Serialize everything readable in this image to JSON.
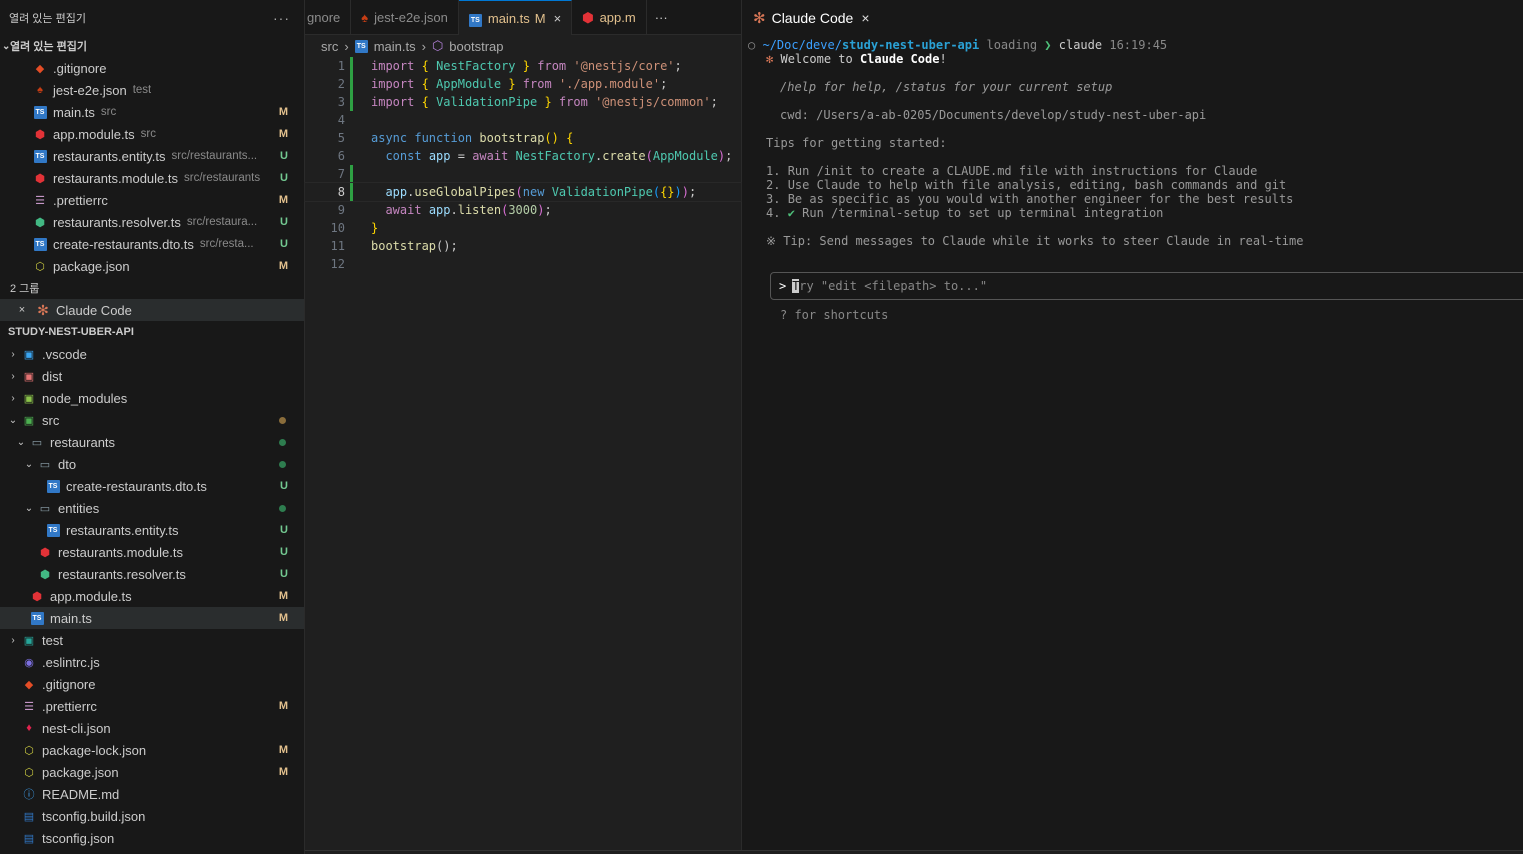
{
  "sidebar": {
    "header": "열려 있는 편집기",
    "more": "···",
    "open_editors_title": "열려 있는 편집기",
    "open_editors": [
      {
        "name": ".gitignore",
        "hint": "",
        "badge": "",
        "icon": "git-icon"
      },
      {
        "name": "jest-e2e.json",
        "hint": "test",
        "badge": "",
        "icon": "jest-icon"
      },
      {
        "name": "main.ts",
        "hint": "src",
        "badge": "M",
        "icon": "ts-icon"
      },
      {
        "name": "app.module.ts",
        "hint": "src",
        "badge": "M",
        "icon": "angular-icon"
      },
      {
        "name": "restaurants.entity.ts",
        "hint": "src/restaurants...",
        "badge": "U",
        "icon": "ts-icon"
      },
      {
        "name": "restaurants.module.ts",
        "hint": "src/restaurants",
        "badge": "U",
        "icon": "angular-icon"
      },
      {
        "name": ".prettierrc",
        "hint": "",
        "badge": "M",
        "icon": "prettier-icon"
      },
      {
        "name": "restaurants.resolver.ts",
        "hint": "src/restaura...",
        "badge": "U",
        "icon": "resolver-icon"
      },
      {
        "name": "create-restaurants.dto.ts",
        "hint": "src/resta...",
        "badge": "U",
        "icon": "ts-icon"
      },
      {
        "name": "package.json",
        "hint": "",
        "badge": "M",
        "icon": "json-icon"
      }
    ],
    "group2_title": "2 그룹",
    "group2_item": "Claude Code",
    "project_title": "STUDY-NEST-UBER-API",
    "tree": [
      {
        "name": ".vscode",
        "depth": 0,
        "twisty": "›",
        "icon": "vscode-folder-icon",
        "badge": "",
        "dot": ""
      },
      {
        "name": "dist",
        "depth": 0,
        "twisty": "›",
        "icon": "dist-folder-icon",
        "badge": "",
        "dot": ""
      },
      {
        "name": "node_modules",
        "depth": 0,
        "twisty": "›",
        "icon": "node-folder-icon",
        "badge": "",
        "dot": ""
      },
      {
        "name": "src",
        "depth": 0,
        "twisty": "⌄",
        "icon": "src-folder-icon",
        "badge": "",
        "dot": "#8a6d3b"
      },
      {
        "name": "restaurants",
        "depth": 1,
        "twisty": "⌄",
        "icon": "folder-icon",
        "badge": "",
        "dot": "#2e7d4f"
      },
      {
        "name": "dto",
        "depth": 2,
        "twisty": "⌄",
        "icon": "folder-icon",
        "badge": "",
        "dot": "#2e7d4f"
      },
      {
        "name": "create-restaurants.dto.ts",
        "depth": 3,
        "twisty": "",
        "icon": "ts-icon",
        "badge": "U",
        "dot": ""
      },
      {
        "name": "entities",
        "depth": 2,
        "twisty": "⌄",
        "icon": "folder-icon",
        "badge": "",
        "dot": "#2e7d4f"
      },
      {
        "name": "restaurants.entity.ts",
        "depth": 3,
        "twisty": "",
        "icon": "ts-icon",
        "badge": "U",
        "dot": ""
      },
      {
        "name": "restaurants.module.ts",
        "depth": 2,
        "twisty": "",
        "icon": "angular-icon",
        "badge": "U",
        "dot": ""
      },
      {
        "name": "restaurants.resolver.ts",
        "depth": 2,
        "twisty": "",
        "icon": "resolver-icon",
        "badge": "U",
        "dot": ""
      },
      {
        "name": "app.module.ts",
        "depth": 1,
        "twisty": "",
        "icon": "angular-icon",
        "badge": "M",
        "dot": ""
      },
      {
        "name": "main.ts",
        "depth": 1,
        "twisty": "",
        "icon": "ts-icon",
        "badge": "M",
        "dot": "",
        "selected": true
      },
      {
        "name": "test",
        "depth": 0,
        "twisty": "›",
        "icon": "test-folder-icon",
        "badge": "",
        "dot": ""
      },
      {
        "name": ".eslintrc.js",
        "depth": 0,
        "twisty": "",
        "icon": "eslint-icon",
        "badge": "",
        "dot": ""
      },
      {
        "name": ".gitignore",
        "depth": 0,
        "twisty": "",
        "icon": "git-icon",
        "badge": "",
        "dot": ""
      },
      {
        "name": ".prettierrc",
        "depth": 0,
        "twisty": "",
        "icon": "prettier-icon",
        "badge": "M",
        "dot": ""
      },
      {
        "name": "nest-cli.json",
        "depth": 0,
        "twisty": "",
        "icon": "nest-icon",
        "badge": "",
        "dot": ""
      },
      {
        "name": "package-lock.json",
        "depth": 0,
        "twisty": "",
        "icon": "json-icon",
        "badge": "M",
        "dot": ""
      },
      {
        "name": "package.json",
        "depth": 0,
        "twisty": "",
        "icon": "json-icon",
        "badge": "M",
        "dot": ""
      },
      {
        "name": "README.md",
        "depth": 0,
        "twisty": "",
        "icon": "info-icon",
        "badge": "",
        "dot": ""
      },
      {
        "name": "tsconfig.build.json",
        "depth": 0,
        "twisty": "",
        "icon": "tsconfig-icon",
        "badge": "",
        "dot": ""
      },
      {
        "name": "tsconfig.json",
        "depth": 0,
        "twisty": "",
        "icon": "tsconfig-icon",
        "badge": "",
        "dot": ""
      }
    ]
  },
  "editor": {
    "tabs": [
      {
        "label": "gnore",
        "mod": "",
        "icon": "",
        "active": false,
        "partial": true
      },
      {
        "label": "jest-e2e.json",
        "mod": "",
        "icon": "jest-icon",
        "active": false
      },
      {
        "label": "main.ts",
        "mod": "M",
        "icon": "ts-icon",
        "active": true
      },
      {
        "label": "app.m",
        "mod": "",
        "icon": "angular-icon",
        "active": false
      }
    ],
    "close_glyph": "×",
    "more": "···",
    "breadcrumb": {
      "a": "src",
      "b": "main.ts",
      "c": "bootstrap"
    },
    "lines": [
      {
        "n": "1",
        "changed": true
      },
      {
        "n": "2",
        "changed": true
      },
      {
        "n": "3",
        "changed": true
      },
      {
        "n": "4",
        "changed": false
      },
      {
        "n": "5",
        "changed": false
      },
      {
        "n": "6",
        "changed": false
      },
      {
        "n": "7",
        "changed": true
      },
      {
        "n": "8",
        "changed": true
      },
      {
        "n": "9",
        "changed": false
      },
      {
        "n": "10",
        "changed": false
      },
      {
        "n": "11",
        "changed": false
      },
      {
        "n": "12",
        "changed": false
      }
    ],
    "tokens": {
      "import": "import",
      "from": "from",
      "lb": "{ ",
      "rb": " }",
      "NestFactory": "NestFactory",
      "core": "'@nestjs/core'",
      "semi": ";",
      "AppModule": "AppModule",
      "appmod": "'./app.module'",
      "ValidationPipe": "ValidationPipe",
      "common": "'@nestjs/common'",
      "async": "async",
      "function": "function",
      "bootstrap": "bootstrap",
      "paren": "()",
      "brace_open": " {",
      "const": "const",
      "app": "app",
      "eq": " = ",
      "await": "await",
      "dot": ".",
      "create": "create",
      "lp": "(",
      "rp": ")",
      "useGlobalPipes": "useGlobalPipes",
      "new": "new",
      "emptyobj": "{}",
      "listen": "listen",
      "port": "3000",
      "close_brace": "}",
      "call": "bootstrap();"
    }
  },
  "claude": {
    "tab_label": "Claude Code",
    "tab_close": "×",
    "prompt": {
      "circle": "○",
      "path_dim": "~/Doc/deve/",
      "path_bold": "study-nest-uber-api",
      "loading": "loading",
      "arrow": "❯",
      "cmd": "claude",
      "time": "16:19:45"
    },
    "welcome_star": "✻",
    "welcome_pre": "Welcome to ",
    "welcome_bold": "Claude Code",
    "welcome_post": "!",
    "help": "/help for help, /status for your current setup",
    "cwd": "cwd: /Users/a-ab-0205/Documents/develop/study-nest-uber-api",
    "tips_title": "Tips for getting started:",
    "tips": [
      {
        "n": "1.",
        "text": "Run /init to create a CLAUDE.md file with instructions for Claude",
        "check": ""
      },
      {
        "n": "2.",
        "text": "Use Claude to help with file analysis, editing, bash commands and git",
        "check": ""
      },
      {
        "n": "3.",
        "text": "Be as specific as you would with another engineer for the best results",
        "check": ""
      },
      {
        "n": "4.",
        "text": "Run /terminal-setup to set up terminal integration",
        "check": "✔"
      }
    ],
    "tip_star": "※",
    "tip_line": "Tip: Send messages to Claude while it works to steer Claude in real-time",
    "input_prompt": ">",
    "input_cursor": "T",
    "input_placeholder": "ry \"edit <filepath> to...\"",
    "shortcuts": "? for shortcuts"
  }
}
